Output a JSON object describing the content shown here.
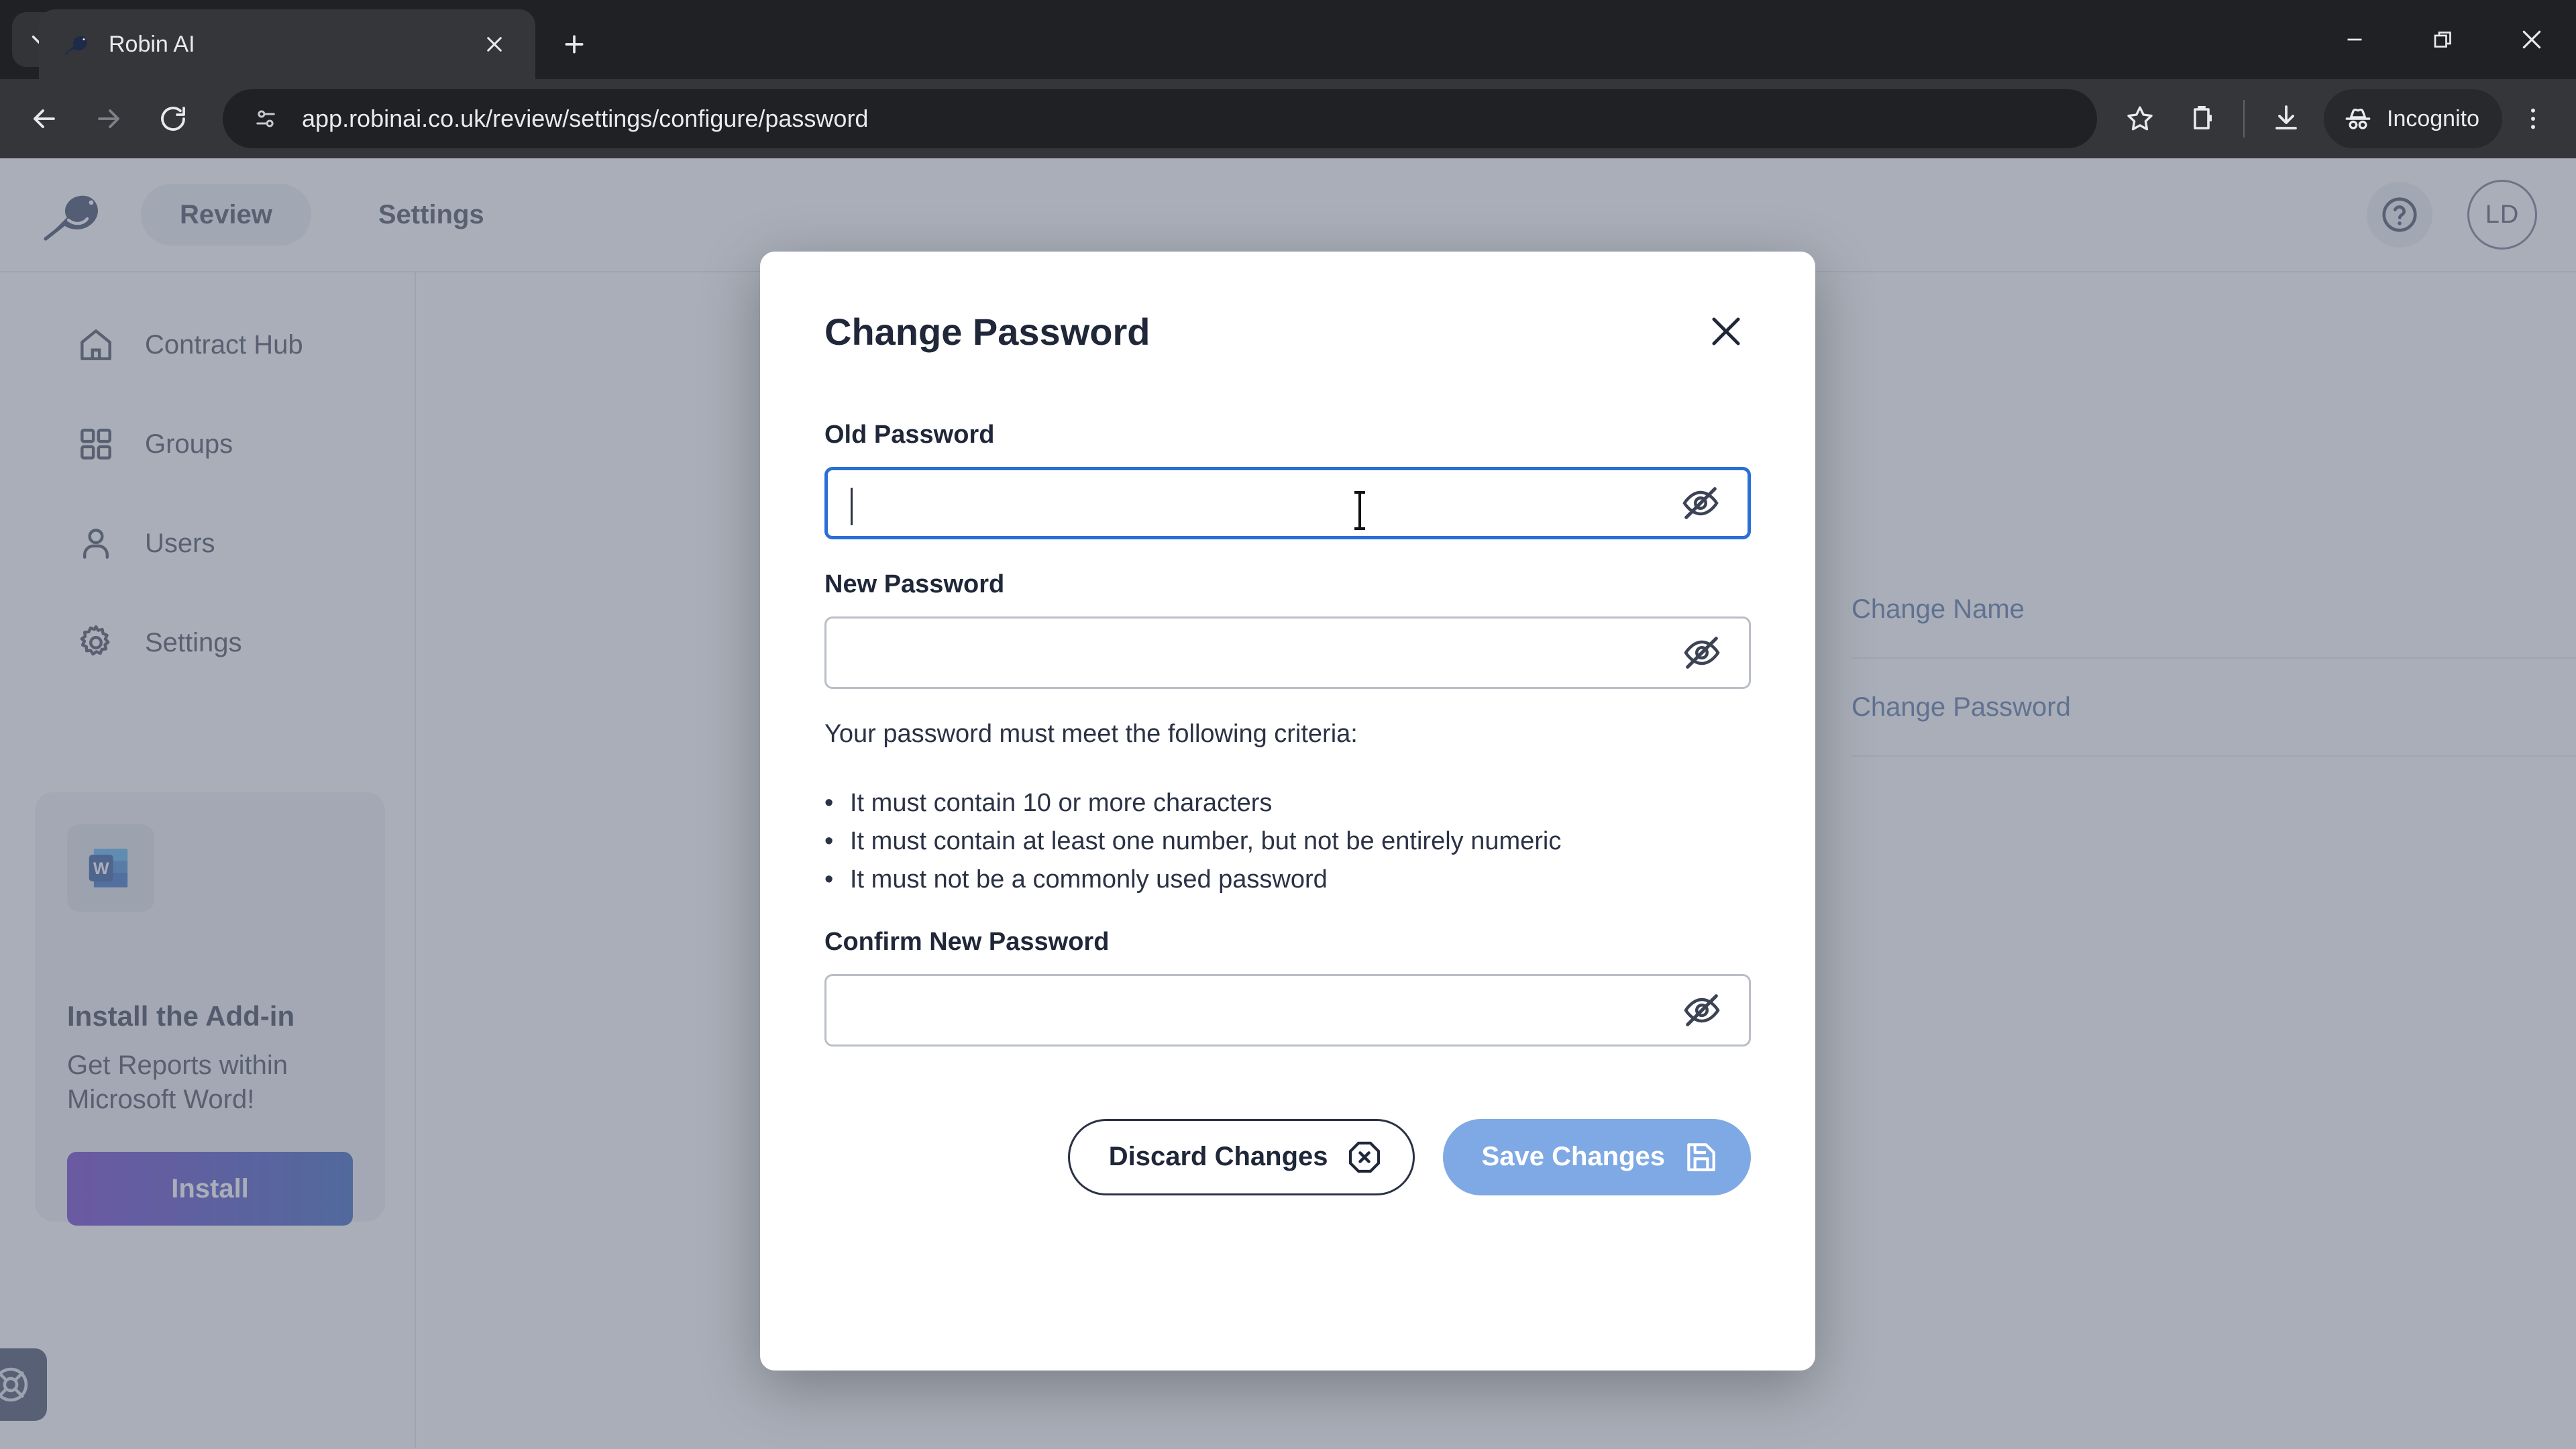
{
  "browser": {
    "tab_search_icon": "chevron-down-icon",
    "tab": {
      "title": "Robin AI",
      "favicon": "robin-bird-favicon",
      "close_icon": "close-icon"
    },
    "new_tab_icon": "plus-icon",
    "window_controls": {
      "minimize": "minimize-icon",
      "restore": "restore-icon",
      "close": "close-icon"
    },
    "nav": {
      "back": "back-arrow-icon",
      "forward": "forward-arrow-icon",
      "reload": "reload-icon"
    },
    "omnibox": {
      "site_info_icon": "site-settings-icon",
      "url": "app.robinai.co.uk/review/settings/configure/password"
    },
    "toolbar_right": {
      "bookmark_icon": "star-icon",
      "extensions_icon": "extensions-icon",
      "downloads_icon": "download-icon",
      "incognito_label": "Incognito",
      "incognito_icon": "incognito-hat-icon",
      "menu_icon": "three-dots-vertical-icon"
    }
  },
  "app": {
    "header": {
      "logo_icon": "robin-bird-logo",
      "active_nav": "Review",
      "nav_link": "Settings",
      "help_icon": "help-circle-icon",
      "avatar_initials": "LD"
    },
    "sidebar": {
      "items": [
        {
          "label": "Contract Hub",
          "icon": "home-icon"
        },
        {
          "label": "Groups",
          "icon": "grid-icon"
        },
        {
          "label": "Users",
          "icon": "user-icon"
        },
        {
          "label": "Settings",
          "icon": "gear-icon"
        }
      ],
      "promo": {
        "icon": "microsoft-word-icon",
        "title": "Install the Add-in",
        "description": "Get Reports within Microsoft Word!",
        "button_label": "Install",
        "gradient_start": "#5b21c7",
        "gradient_end": "#1a4bb5"
      },
      "support_icon": "lifebuoy-icon"
    },
    "settings_rows": [
      {
        "label": "Change Name"
      },
      {
        "label": "Change Password"
      }
    ],
    "link_color": "#3f6099"
  },
  "modal": {
    "title": "Change Password",
    "close_icon": "close-icon",
    "fields": [
      {
        "label": "Old Password",
        "value": "",
        "placeholder": "",
        "focused": true,
        "toggle_icon": "eye-off-icon"
      },
      {
        "label": "New Password",
        "value": "",
        "placeholder": "",
        "focused": false,
        "toggle_icon": "eye-off-icon"
      },
      {
        "label": "Confirm New Password",
        "value": "",
        "placeholder": "",
        "focused": false,
        "toggle_icon": "eye-off-icon"
      }
    ],
    "criteria_intro": "Your password must meet the following criteria:",
    "criteria": [
      "It must contain 10 or more characters",
      "It must contain at least one number, but not be entirely numeric",
      "It must not be a commonly used password"
    ],
    "bullet_glyph": "•",
    "footer": {
      "discard_label": "Discard Changes",
      "discard_icon": "octagon-x-icon",
      "save_label": "Save Changes",
      "save_icon": "save-floppy-icon",
      "save_color": "#7fa9e4"
    }
  },
  "cursor": {
    "type": "text-ibeam-cursor"
  }
}
